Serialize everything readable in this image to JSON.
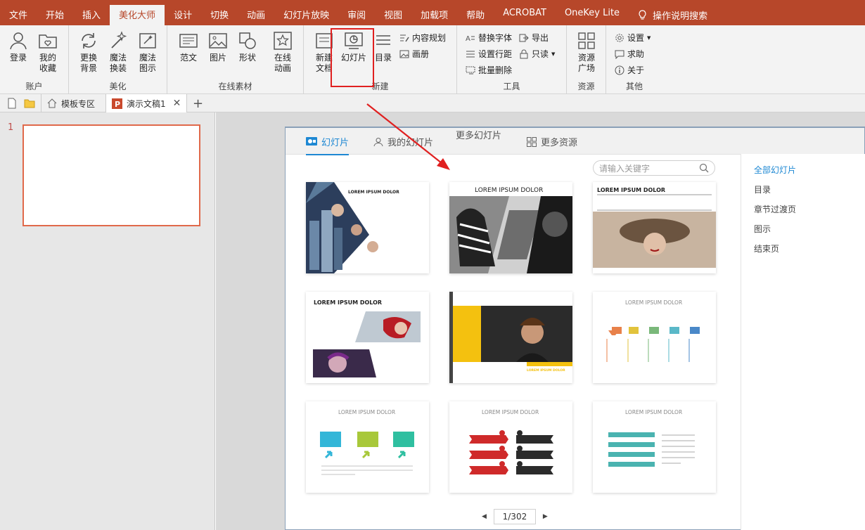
{
  "menu": [
    "文件",
    "开始",
    "插入",
    "美化大师",
    "设计",
    "切换",
    "动画",
    "幻灯片放映",
    "审阅",
    "视图",
    "加载项",
    "帮助",
    "ACROBAT",
    "OneKey Lite",
    "操作说明搜索"
  ],
  "ribbon": {
    "account": {
      "label": "账户",
      "login": "登录",
      "fav_line1": "我的",
      "fav_line2": "收藏"
    },
    "beautify": {
      "label": "美化",
      "b1a": "更换",
      "b1b": "背景",
      "b2a": "魔法",
      "b2b": "换装",
      "b3a": "魔法",
      "b3b": "图示"
    },
    "online": {
      "label": "在线素材",
      "sample": "范文",
      "image": "图片",
      "shape": "形状",
      "anim_a": "在线",
      "anim_b": "动画"
    },
    "newgrp": {
      "label": "新建",
      "newdoc_a": "新建",
      "newdoc_b": "文档",
      "slide": "幻灯片",
      "toc": "目录",
      "plan": "内容规划",
      "album": "画册"
    },
    "tools": {
      "label": "工具",
      "replace_font": "替换字体",
      "line_spacing": "设置行距",
      "batch_delete": "批量删除",
      "export": "导出",
      "readonly": "只读"
    },
    "resource": {
      "label": "资源",
      "res_a": "资源",
      "res_b": "广场"
    },
    "other": {
      "label": "其他",
      "settings": "设置",
      "help": "求助",
      "about": "关于"
    }
  },
  "doctabs": {
    "template_zone": "模板专区",
    "doc_title": "演示文稿1"
  },
  "slides": {
    "number": "1"
  },
  "panel": {
    "tab_slides": "幻灯片",
    "tab_mine": "我的幻灯片",
    "more_slides": "更多幻灯片",
    "tab_more": "更多资源",
    "search_placeholder": "请输入关键字",
    "categories": [
      "全部幻灯片",
      "目录",
      "章节过渡页",
      "图示",
      "结束页"
    ],
    "pager": "1/302"
  },
  "cards": {
    "c1": "LOREM IPSUM DOLOR",
    "c2": "LOREM IPSUM DOLOR",
    "c3": "LOREM IPSUM DOLOR",
    "c4": "LOREM IPSUM DOLOR",
    "c6": "LOREM IPSUM DOLOR",
    "c7": "LOREM IPSUM DOLOR",
    "c8": "LOREM IPSUM DOLOR",
    "c9": "LOREM IPSUM DOLOR"
  },
  "colors": {
    "accent": "#b7472a",
    "link": "#1e88d3",
    "highlight": "#e02020"
  }
}
